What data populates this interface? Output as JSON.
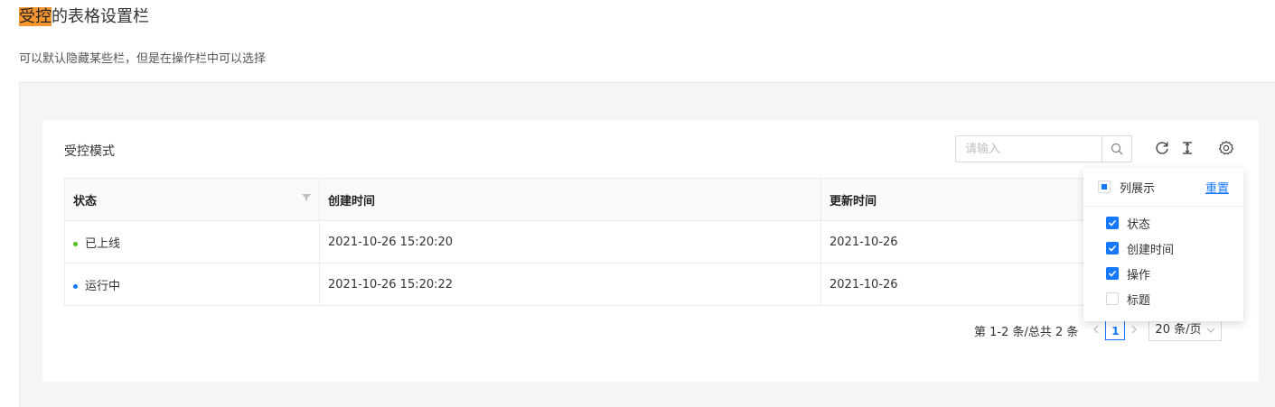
{
  "page": {
    "title_highlight": "受控",
    "title_rest": "的表格设置栏",
    "description": "可以默认隐藏某些栏，但是在操作栏中可以选择"
  },
  "card": {
    "title": "受控模式",
    "search_placeholder": "请输入"
  },
  "toolbar_icons": [
    "search-icon",
    "reload-icon",
    "density-icon",
    "setting-icon"
  ],
  "table": {
    "columns": [
      "状态",
      "创建时间",
      "更新时间"
    ],
    "rows": [
      {
        "status": "已上线",
        "status_color": "#52c41a",
        "created": "2021-10-26 15:20:20",
        "updated": "2021-10-26"
      },
      {
        "status": "运行中",
        "status_color": "#1677ff",
        "created": "2021-10-26 15:20:22",
        "updated": "2021-10-26"
      }
    ]
  },
  "pagination": {
    "summary": "第 1-2 条/总共 2 条",
    "current_page": "1",
    "page_size": "20 条/页"
  },
  "column_settings": {
    "header_label": "列展示",
    "reset_label": "重置",
    "items": [
      {
        "label": "状态",
        "checked": true
      },
      {
        "label": "创建时间",
        "checked": true
      },
      {
        "label": "操作",
        "checked": true
      },
      {
        "label": "标题",
        "checked": false
      }
    ]
  },
  "colors": {
    "accent": "#1677ff",
    "highlight": "#f7962f"
  }
}
